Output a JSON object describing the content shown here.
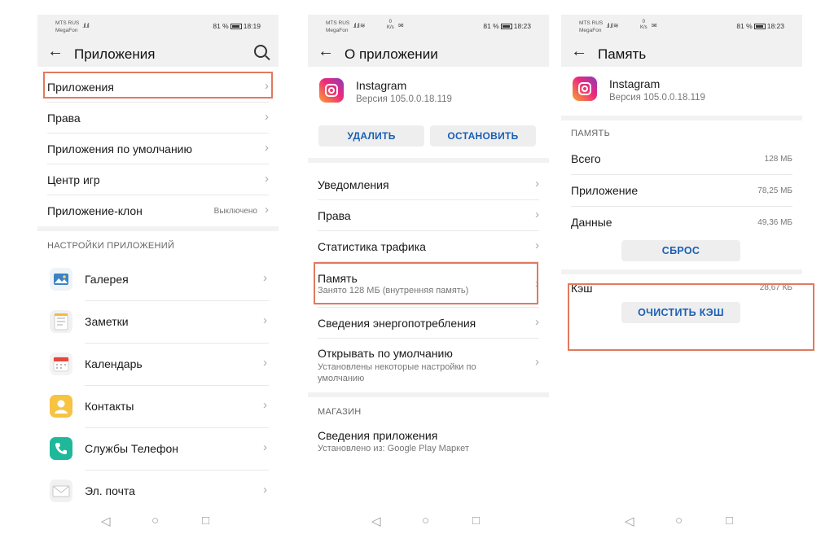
{
  "status": {
    "carrier1": "MTS RUS",
    "carrier2": "MegaFon",
    "battery": "81 %",
    "speed": "0\nK/s",
    "time1": "18:19",
    "time2": "18:23",
    "time3": "18:23"
  },
  "screen1": {
    "title": "Приложения",
    "rows": [
      {
        "label": "Приложения"
      },
      {
        "label": "Права"
      },
      {
        "label": "Приложения по умолчанию"
      },
      {
        "label": "Центр игр"
      },
      {
        "label": "Приложение-клон",
        "value": "Выключено"
      }
    ],
    "section": "НАСТРОЙКИ ПРИЛОЖЕНИЙ",
    "apps": [
      {
        "name": "Галерея",
        "icon": "gallery-icon"
      },
      {
        "name": "Заметки",
        "icon": "notes-icon"
      },
      {
        "name": "Календарь",
        "icon": "calendar-icon"
      },
      {
        "name": "Контакты",
        "icon": "contacts-icon"
      },
      {
        "name": "Службы Телефон",
        "icon": "phone-icon"
      },
      {
        "name": "Эл. почта",
        "icon": "email-icon"
      }
    ]
  },
  "screen2": {
    "title": "О приложении",
    "app_name": "Instagram",
    "version": "Версия 105.0.0.18.119",
    "uninstall": "УДАЛИТЬ",
    "stop": "ОСТАНОВИТЬ",
    "rows": [
      {
        "label": "Уведомления"
      },
      {
        "label": "Права"
      },
      {
        "label": "Статистика трафика"
      },
      {
        "label": "Память",
        "sub": "Занято 128 МБ (внутренняя память)"
      },
      {
        "label": "Сведения энергопотребления"
      },
      {
        "label": "Открывать по умолчанию",
        "sub": "Установлены некоторые настройки по умолчанию"
      }
    ],
    "store_section": "МАГАЗИН",
    "store_row": {
      "label": "Сведения приложения",
      "sub": "Установлено из: Google Play Маркет"
    }
  },
  "screen3": {
    "title": "Память",
    "app_name": "Instagram",
    "version": "Версия 105.0.0.18.119",
    "section": "ПАМЯТЬ",
    "rows": [
      {
        "label": "Всего",
        "value": "128 МБ"
      },
      {
        "label": "Приложение",
        "value": "78,25 МБ"
      },
      {
        "label": "Данные",
        "value": "49,36 МБ"
      }
    ],
    "reset": "СБРОС",
    "cache_label": "Кэш",
    "cache_value": "28,67 КБ",
    "clear_cache": "ОЧИСТИТЬ КЭШ"
  },
  "colors": {
    "highlight": "#e07a5f",
    "accent": "#1a5fb4"
  }
}
